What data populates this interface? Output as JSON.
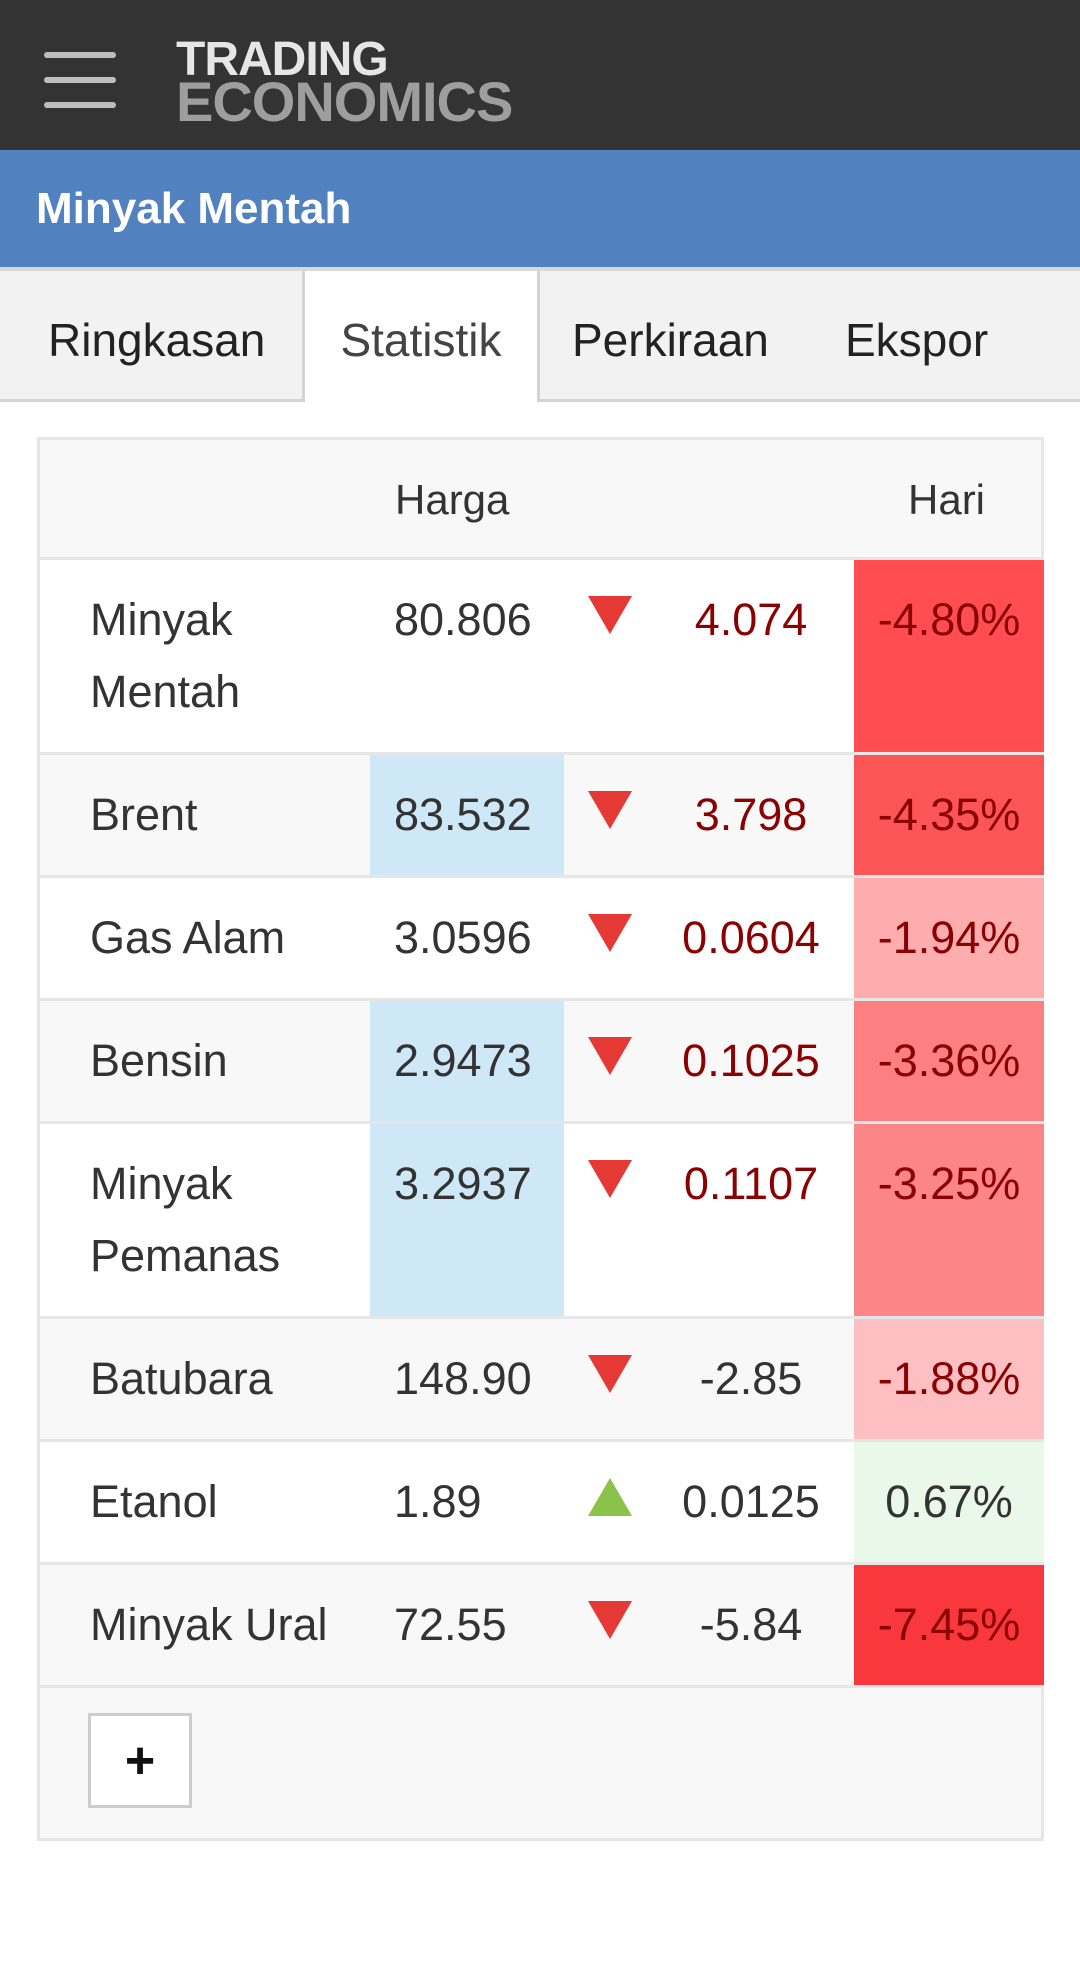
{
  "header": {
    "logo_line1": "TRADING",
    "logo_line2": "ECONOMICS"
  },
  "page_title": "Minyak Mentah",
  "tabs": [
    {
      "label": "Ringkasan",
      "active": false
    },
    {
      "label": "Statistik",
      "active": true
    },
    {
      "label": "Perkiraan",
      "active": false
    },
    {
      "label": "Ekspor",
      "active": false
    }
  ],
  "table": {
    "headers": {
      "price": "Harga",
      "day": "Hari"
    },
    "rows": [
      {
        "name_line1": "Minyak",
        "name_line2": "Mentah",
        "price": "80.806",
        "direction": "down",
        "change": "4.074",
        "pct": "-4.80%",
        "pct_color": "#ff4d52",
        "price_highlight": false
      },
      {
        "name_line1": "Brent",
        "name_line2": "",
        "price": "83.532",
        "direction": "down",
        "change": "3.798",
        "pct": "-4.35%",
        "pct_color": "#fb5558",
        "price_highlight": true
      },
      {
        "name_line1": "Gas Alam",
        "name_line2": "",
        "price": "3.0596",
        "direction": "down",
        "change": "0.0604",
        "pct": "-1.94%",
        "pct_color": "#fdadae",
        "price_highlight": false
      },
      {
        "name_line1": "Bensin",
        "name_line2": "",
        "price": "2.9473",
        "direction": "down",
        "change": "0.1025",
        "pct": "-3.36%",
        "pct_color": "#fc8082",
        "price_highlight": true
      },
      {
        "name_line1": "Minyak",
        "name_line2": "Pemanas",
        "price": "3.2937",
        "direction": "down",
        "change": "0.1107",
        "pct": "-3.25%",
        "pct_color": "#fc8587",
        "price_highlight": true
      },
      {
        "name_line1": "Batubara",
        "name_line2": "",
        "price": "148.90",
        "direction": "down",
        "change": "-2.85",
        "pct": "-1.88%",
        "pct_color": "#fdbfc1",
        "price_highlight": false
      },
      {
        "name_line1": "Etanol",
        "name_line2": "",
        "price": "1.89",
        "direction": "up",
        "change": "0.0125",
        "pct": "0.67%",
        "pct_color": "#eaf8ea",
        "price_highlight": false
      },
      {
        "name_line1": "Minyak Ural",
        "name_line2": "",
        "price": "72.55",
        "direction": "down",
        "change": "-5.84",
        "pct": "-7.45%",
        "pct_color": "#f8383c",
        "price_highlight": false
      }
    ]
  },
  "more_button": "+"
}
